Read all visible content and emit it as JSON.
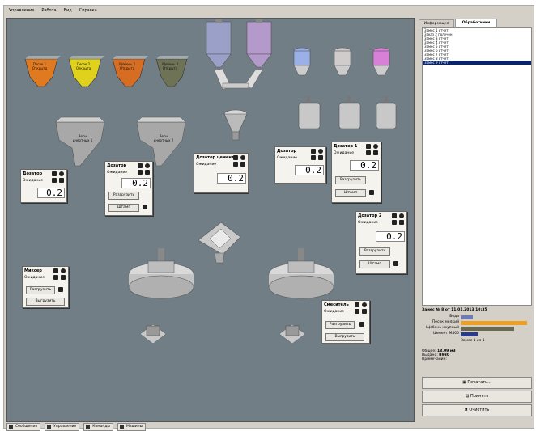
{
  "menu": [
    "Управление",
    "Работа",
    "Вид",
    "Справка"
  ],
  "hoppers": [
    {
      "name": "Песок 1",
      "state": "Открыта",
      "color": "#e07a20"
    },
    {
      "name": "Песок 2",
      "state": "Открыта",
      "color": "#e0d21c"
    },
    {
      "name": "Щебень 1",
      "state": "Открыта",
      "color": "#d76d22"
    },
    {
      "name": "Щебень 2",
      "state": "Открыта",
      "color": "#6f7356"
    }
  ],
  "weighers": [
    {
      "name": "Весы инертных 1"
    },
    {
      "name": "Весы инертных 2"
    }
  ],
  "silo_colors": [
    "#9aa0c8",
    "#b49acb",
    "#9ab0e6",
    "#d0cccc",
    "#d87fd8"
  ],
  "panels": {
    "p1": {
      "title": "Дозатор",
      "label": "Ожидание",
      "value": "0.2"
    },
    "p2": {
      "title": "Дозатор",
      "label": "Ожидание",
      "value": "0.2",
      "btn1": "Разгрузить",
      "btn2": "Штамп"
    },
    "p3": {
      "title": "Дозатор цемента",
      "label": "Ожидание",
      "value": "0.2"
    },
    "p4": {
      "title": "Дозатор",
      "label": "Ожидание",
      "value": "0.2"
    },
    "p5": {
      "title": "Дозатор 1",
      "label": "Ожидание",
      "value": "0.2",
      "btn1": "Разгрузить",
      "btn2": "Штамп"
    },
    "p6": {
      "title": "Дозатор 2",
      "label": "Ожидание",
      "value": "0.2",
      "btn1": "Разгрузить",
      "btn2": "Штамп"
    },
    "p7": {
      "title": "Миксер",
      "label": "Ожидание",
      "btn1": "Разгрузить",
      "btn2": "Выгрузить"
    },
    "p8": {
      "title": "Смеситель",
      "label": "Ожидание",
      "btn1": "Разгрузить",
      "btn2": "Выгрузить"
    }
  },
  "tabs": [
    "Информация",
    "Обработчики"
  ],
  "list_items": [
    "Замес 1 отчет",
    "Заказ 2 получен",
    "Замес 3 отчет",
    "Замес 4 отчет",
    "Замес 5 отчет",
    "Замес 6 отчет",
    "Замес 7 отчет",
    "Замес 8 отчет",
    "Замес 9 отчет"
  ],
  "info": {
    "header": "Замес № 8 от 11.01.2013 10:35",
    "rows": [
      {
        "label": "Вода",
        "bar_color": "#6f7ab8",
        "fill": 0.18
      },
      {
        "label": "Песок мелкий",
        "bar_color": "#f0a020",
        "fill": 1.0
      },
      {
        "label": "Щебень крупный",
        "bar_color": "#6a6a50",
        "fill": 0.8
      },
      {
        "label": "Цемент М400",
        "bar_color": "#2a3a8a",
        "fill": 0.25
      }
    ],
    "sub": "Замес 1 из 1",
    "total_label": "Общее:",
    "total_value": "18.09 м3",
    "prod_label": "Выдано:",
    "prod_value": "В930",
    "note_label": "Примечание:"
  },
  "buttons": {
    "print": "Печатать...",
    "save": "Принять",
    "clear": "Очистить"
  },
  "status": [
    "Сообщения",
    "Управление",
    "Команды",
    "Машины"
  ]
}
